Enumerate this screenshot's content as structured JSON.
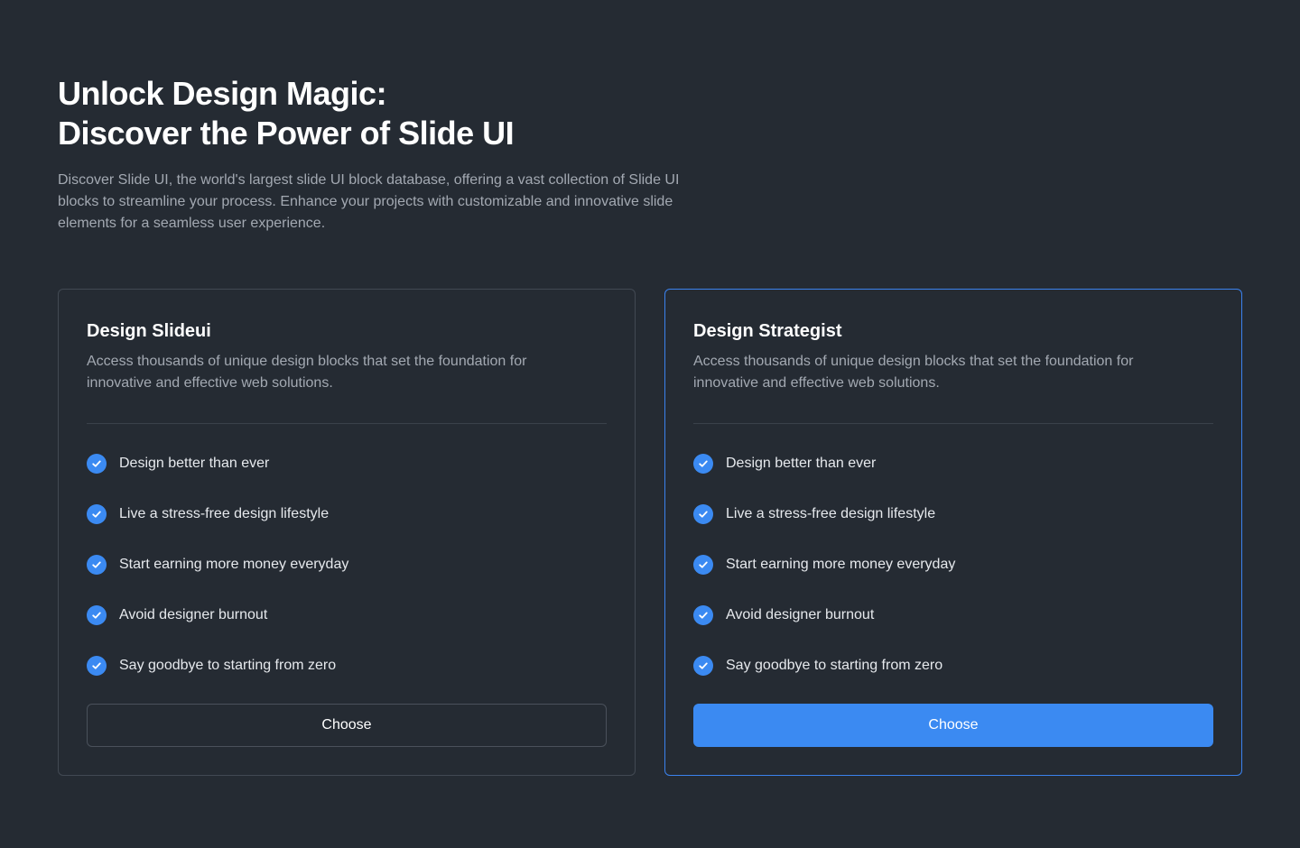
{
  "hero": {
    "title_line1": "Unlock Design Magic:",
    "title_line2": "Discover the Power of Slide UI",
    "description": "Discover Slide UI, the world's largest slide UI block database, offering a vast collection of Slide UI blocks to streamline your process. Enhance your projects with customizable and innovative slide elements for a seamless user experience."
  },
  "colors": {
    "background": "#252b33",
    "accent": "#3b8af2",
    "highlight_border": "#3b82ee",
    "card_border": "#424953",
    "muted_text": "#a3a9b2"
  },
  "cards": [
    {
      "title": "Design Slideui",
      "description": "Access thousands of unique design blocks that set the foundation for innovative and effective web solutions.",
      "features": [
        "Design better than ever",
        "Live a stress-free design lifestyle",
        "Start earning more money everyday",
        "Avoid designer burnout",
        "Say goodbye to starting from zero"
      ],
      "button_label": "Choose",
      "button_style": "outline",
      "icon": "check-circle-icon"
    },
    {
      "title": "Design Strategist",
      "description": "Access thousands of unique design blocks that set the foundation for innovative and effective web solutions.",
      "features": [
        "Design better than ever",
        "Live a stress-free design lifestyle",
        "Start earning more money everyday",
        "Avoid designer burnout",
        "Say goodbye to starting from zero"
      ],
      "button_label": "Choose",
      "button_style": "primary",
      "icon": "check-circle-icon"
    }
  ]
}
